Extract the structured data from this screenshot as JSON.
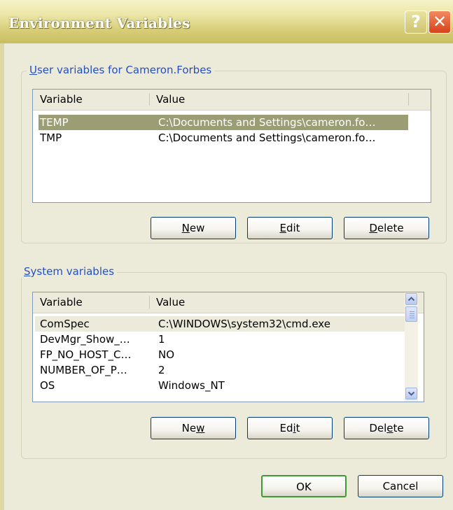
{
  "window": {
    "title": "Environment Variables",
    "help_glyph": "?",
    "close_glyph": "✕"
  },
  "user_group": {
    "legend_prefix": "U",
    "legend_rest": "ser variables for Cameron.Forbes",
    "columns": [
      "Variable",
      "Value"
    ],
    "rows": [
      {
        "name": "TEMP",
        "value": "C:\\Documents and Settings\\cameron.fo…"
      },
      {
        "name": "TMP",
        "value": "C:\\Documents and Settings\\cameron.fo…"
      }
    ],
    "buttons": {
      "new": {
        "pre": "",
        "key": "N",
        "post": "ew"
      },
      "edit": {
        "pre": "",
        "key": "E",
        "post": "dit"
      },
      "delete": {
        "pre": "",
        "key": "D",
        "post": "elete"
      }
    }
  },
  "system_group": {
    "legend_prefix": "S",
    "legend_rest": "ystem variables",
    "columns": [
      "Variable",
      "Value"
    ],
    "rows": [
      {
        "name": "ComSpec",
        "value": "C:\\WINDOWS\\system32\\cmd.exe"
      },
      {
        "name": "DevMgr_Show_…",
        "value": "1"
      },
      {
        "name": "FP_NO_HOST_C…",
        "value": "NO"
      },
      {
        "name": "NUMBER_OF_P…",
        "value": "2"
      },
      {
        "name": "OS",
        "value": "Windows_NT"
      }
    ],
    "buttons": {
      "new": {
        "pre": "Ne",
        "key": "w",
        "post": ""
      },
      "edit": {
        "pre": "Ed",
        "key": "i",
        "post": "t"
      },
      "delete": {
        "pre": "Del",
        "key": "e",
        "post": "te"
      }
    }
  },
  "dialog_buttons": {
    "ok": "OK",
    "cancel": "Cancel"
  }
}
